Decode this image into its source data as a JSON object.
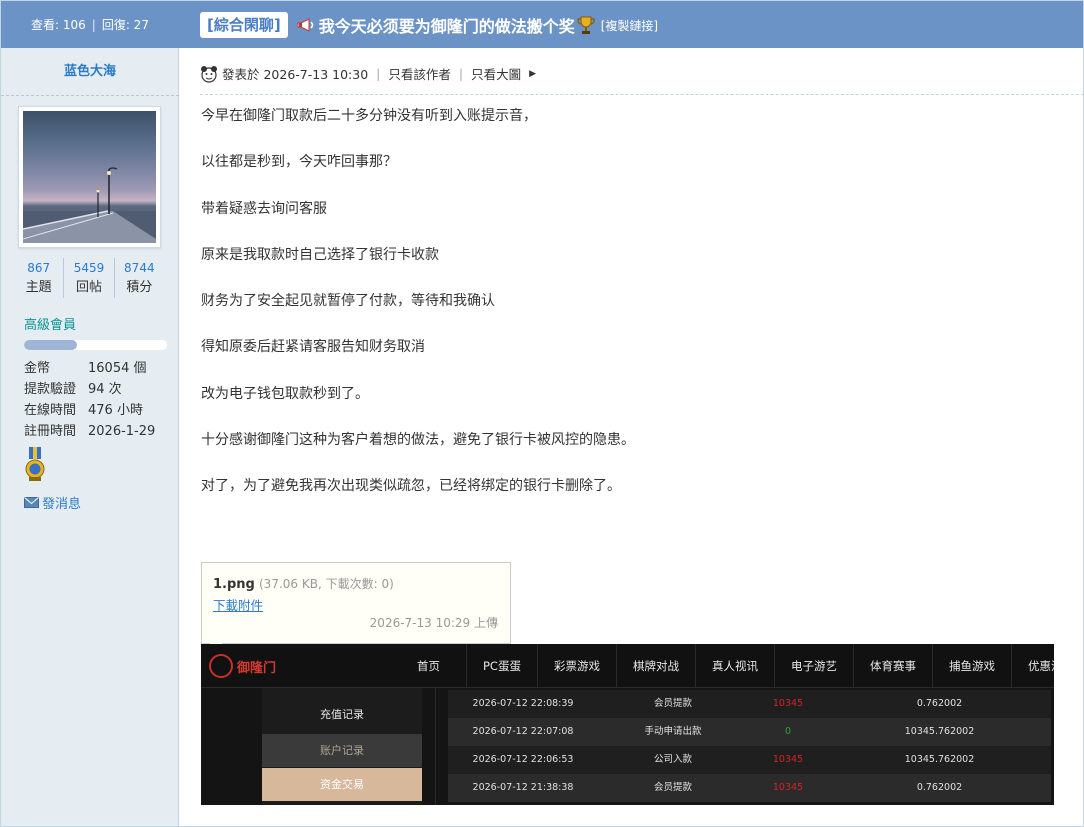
{
  "header": {
    "views_label": "查看: 106",
    "sep": "|",
    "replies_label": "回復: 27",
    "forum_tag": "[綜合閑聊]",
    "thread_title": "我今天必须要为御隆门的做法搬个奖",
    "copy_link": "[複製鏈接]"
  },
  "author": {
    "name": "蓝色大海",
    "stats": [
      {
        "num": "867",
        "label": "主題"
      },
      {
        "num": "5459",
        "label": "回帖"
      },
      {
        "num": "8744",
        "label": "積分"
      }
    ],
    "rank": "高級會員",
    "rank_progress": 0.37,
    "info": [
      {
        "k": "金幣",
        "v": "16054 個"
      },
      {
        "k": "提款驗證",
        "v": "94 次"
      },
      {
        "k": "在線時間",
        "v": "476 小時"
      },
      {
        "k": "註冊時間",
        "v": "2026-1-29"
      }
    ],
    "send_message": "發消息"
  },
  "post": {
    "posted_at": "發表於 2026-7-13 10:30",
    "sep": "|",
    "author_only": "只看該作者",
    "big_image": "只看大圖",
    "paragraphs": [
      "今早在御隆门取款后二十多分钟没有听到入账提示音，",
      "以往都是秒到，今天咋回事那？",
      "带着疑惑去询问客服",
      "原来是我取款时自己选择了银行卡收款",
      "财务为了安全起见就暂停了付款，等待和我确认",
      "得知原委后赶紧请客服告知财务取消",
      "改为电子钱包取款秒到了。",
      "十分感谢御隆门这种为客户着想的做法，避免了银行卡被风控的隐患。",
      "对了，为了避免我再次出现类似疏忽，已经将绑定的银行卡删除了。"
    ]
  },
  "attachment": {
    "filename": "1.png",
    "meta": "(37.06 KB, 下載次數: 0)",
    "download": "下載附件",
    "uploaded": "2026-7-13 10:29 上傳"
  },
  "screenshot": {
    "logo_text": "御隆门",
    "nav": [
      "首页",
      "PC蛋蛋",
      "彩票游戏",
      "棋牌对战",
      "真人视讯",
      "电子游艺",
      "体育赛事",
      "捕鱼游戏",
      "优惠活动"
    ],
    "side": [
      "充值记录",
      "账户记录",
      "资金交易"
    ],
    "rows": [
      {
        "time": "2026-07-12 22:08:39",
        "type": "会员提款",
        "amount": "10345",
        "balance": "0.762002",
        "color": "red"
      },
      {
        "time": "2026-07-12 22:07:08",
        "type": "手动申请出款",
        "amount": "0",
        "balance": "10345.762002",
        "color": "green"
      },
      {
        "time": "2026-07-12 22:06:53",
        "type": "公司入款",
        "amount": "10345",
        "balance": "10345.762002",
        "color": "red"
      },
      {
        "time": "2026-07-12 21:38:38",
        "type": "会员提款",
        "amount": "10345",
        "balance": "0.762002",
        "color": "red"
      }
    ]
  },
  "colors": {
    "header_bg": "#6c93c6",
    "sidebar_bg": "#e5edf2",
    "link": "#2b7acb",
    "rank": "#0c9292"
  }
}
